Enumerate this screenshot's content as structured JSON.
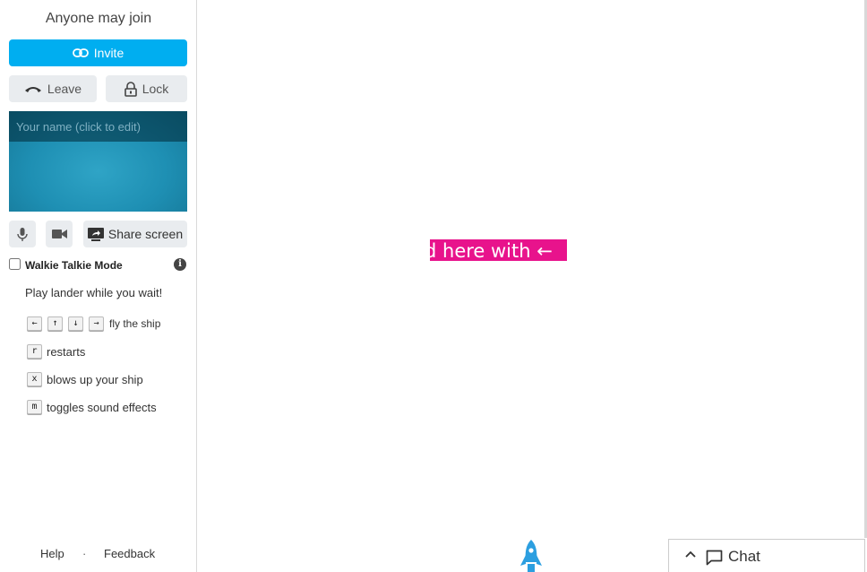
{
  "sidebar": {
    "room_status": "Anyone may join",
    "invite_label": "Invite",
    "leave_label": "Leave",
    "lock_label": "Lock",
    "name_placeholder": "Your name (click to edit)",
    "share_label": "Share screen",
    "walkie_label": "Walkie Talkie Mode",
    "walkie_checked": false,
    "info_glyph": "i",
    "game": {
      "intro": "Play lander while you wait!",
      "arrow_keys": [
        "←",
        "↑",
        "↓",
        "→"
      ],
      "fly_text": "fly the ship",
      "keys": [
        {
          "key": "r",
          "text": "restarts"
        },
        {
          "key": "x",
          "text": "blows up your ship"
        },
        {
          "key": "m",
          "text": "toggles sound effects"
        }
      ]
    },
    "footer": {
      "help": "Help",
      "separator": "·",
      "feedback": "Feedback"
    }
  },
  "stage": {
    "banner_text": "d here with ←",
    "banner_color": "#e8138c"
  },
  "chat": {
    "label": "Chat"
  },
  "colors": {
    "accent": "#00aef0",
    "rocket": "#2c9fe0"
  }
}
